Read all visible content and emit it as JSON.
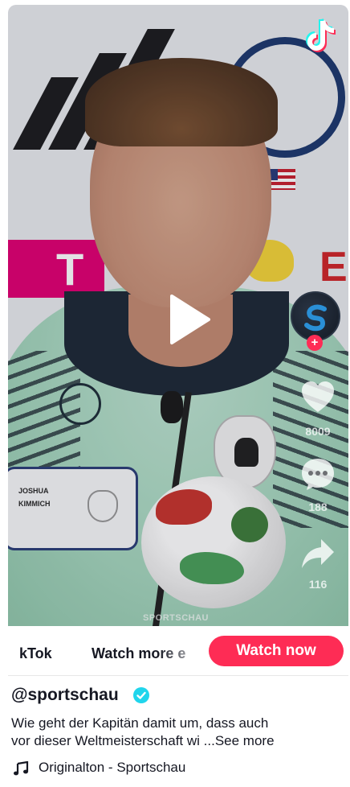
{
  "video": {
    "watermark": "SPORTSCHAU",
    "nameplate": {
      "first": "JOSHUA",
      "last": "KIMMICH"
    },
    "sponsor_letter_t": "T",
    "sponsor_letter_e": "E",
    "stats": {
      "likes": "8009",
      "comments": "188",
      "shares": "116"
    }
  },
  "bottom_bar": {
    "brand": "kTok",
    "watch_more": "Watch more e",
    "watch_now": "Watch now"
  },
  "post": {
    "username": "@sportschau",
    "description_line1": "Wie geht der Kapitän damit um, dass auch",
    "description_line2": "vor dieser Weltmeisterschaft wi ...",
    "see_more": "See more",
    "music": "Originalton - Sportschau"
  },
  "colors": {
    "accent": "#fe2c55",
    "verified": "#20d5ec",
    "text": "#161823"
  },
  "icons": [
    "tiktok-logo-icon",
    "play-icon",
    "heart-icon",
    "comment-icon",
    "share-icon",
    "verified-icon",
    "music-note-icon"
  ]
}
